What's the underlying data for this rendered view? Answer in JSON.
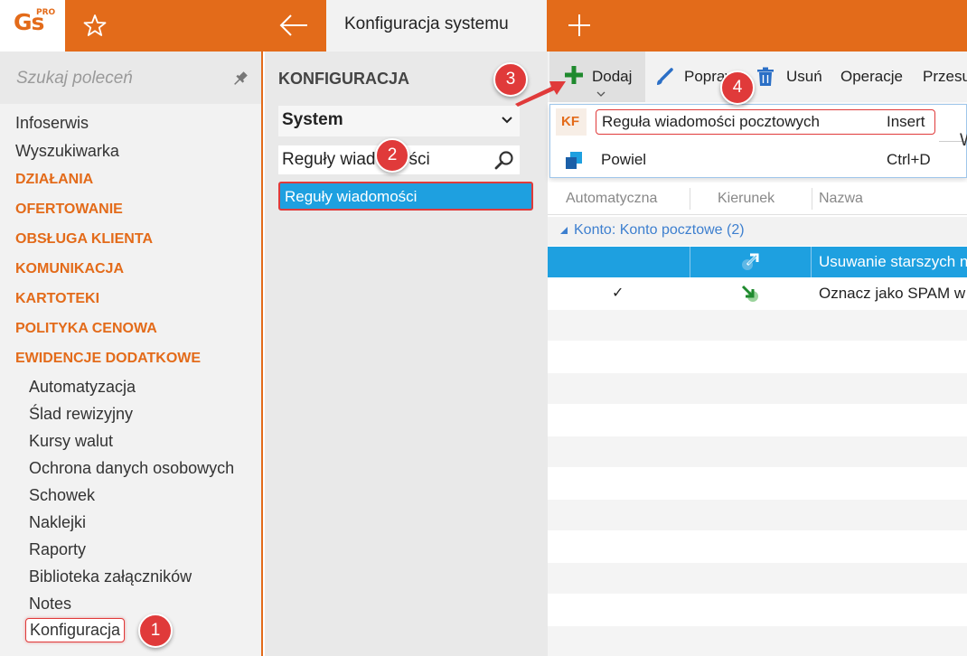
{
  "app": {
    "logo_text": "Gs",
    "logo_sup": "PRO",
    "active_tab": "Konfiguracja systemu",
    "brand_color": "#e36b1a",
    "accent_color": "#1ea0e0",
    "annotation_color": "#e03a3a"
  },
  "sidebar": {
    "search_placeholder": "Szukaj poleceń",
    "items": [
      {
        "label": "Infoserwis"
      },
      {
        "label": "Wyszukiwarka"
      }
    ],
    "categories": [
      {
        "label": "DZIAŁANIA"
      },
      {
        "label": "OFERTOWANIE"
      },
      {
        "label": "OBSŁUGA KLIENTA"
      },
      {
        "label": "KOMUNIKACJA"
      },
      {
        "label": "KARTOTEKI"
      },
      {
        "label": "POLITYKA CENOWA"
      },
      {
        "label": "EWIDENCJE DODATKOWE"
      }
    ],
    "sub_items": [
      {
        "label": "Automatyzacja"
      },
      {
        "label": "Ślad rewizyjny"
      },
      {
        "label": "Kursy walut"
      },
      {
        "label": "Ochrona danych osobowych"
      },
      {
        "label": "Schowek"
      },
      {
        "label": "Naklejki"
      },
      {
        "label": "Raporty"
      },
      {
        "label": "Biblioteka załączników"
      },
      {
        "label": "Notes"
      },
      {
        "label": "Konfiguracja"
      }
    ]
  },
  "middle": {
    "title": "KONFIGURACJA",
    "select_value": "System",
    "filter_value": "Reguły wiadomości",
    "selected_item": "Reguły wiadomości"
  },
  "toolbar": {
    "add_label": "Dodaj",
    "edit_label": "Popraw",
    "delete_label": "Usuń",
    "operations_label": "Operacje",
    "move_label": "Przesu"
  },
  "dropdown": {
    "item1_icon_text": "KF",
    "item1_label": "Reguła wiadomości pocztowych",
    "item1_shortcut": "Insert",
    "item2_label": "Powiel",
    "item2_shortcut": "Ctrl+D",
    "trailing_glyph": "W"
  },
  "grid": {
    "columns": [
      "Automatyczna",
      "Kierunek",
      "Nazwa"
    ],
    "group_label": "Konto: Konto pocztowe (2)",
    "rows": [
      {
        "automatic": "",
        "direction": "outgoing-arrow-icon",
        "name": "Usuwanie starszych n"
      },
      {
        "automatic": "✓",
        "direction": "incoming-arrow-icon",
        "name": "Oznacz jako SPAM w"
      }
    ]
  },
  "annotations": [
    "1",
    "2",
    "3",
    "4"
  ]
}
